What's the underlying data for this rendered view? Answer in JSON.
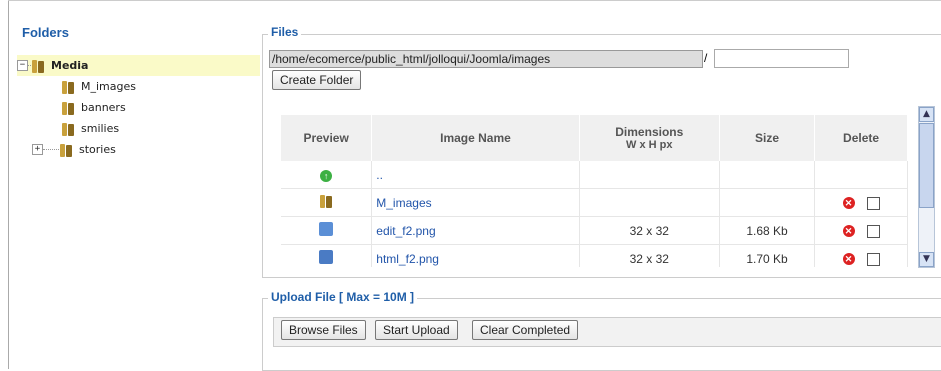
{
  "folders": {
    "title": "Folders",
    "root": "Media",
    "items": [
      {
        "label": "M_images"
      },
      {
        "label": "banners"
      },
      {
        "label": "smilies"
      },
      {
        "label": "stories"
      }
    ],
    "root_expander": "−",
    "stories_expander": "+"
  },
  "files": {
    "legend": "Files",
    "path": "/home/ecomerce/public_html/jolloqui/Joomla/images",
    "slash": "/",
    "new_folder_value": "",
    "create_folder_label": "Create Folder",
    "columns": {
      "preview": "Preview",
      "name": "Image Name",
      "dimensions_line1": "Dimensions",
      "dimensions_line2": "W x H px",
      "size": "Size",
      "delete": "Delete"
    },
    "rows": [
      {
        "name": "..",
        "dimensions": "",
        "size": "",
        "icon": "up-icon"
      },
      {
        "name": "M_images",
        "dimensions": "",
        "size": "",
        "icon": "folder-icon"
      },
      {
        "name": "edit_f2.png",
        "dimensions": "32 x 32",
        "size": "1.68 Kb",
        "icon": "edit-file-icon"
      },
      {
        "name": "html_f2.png",
        "dimensions": "32 x 32",
        "size": "1.70 Kb",
        "icon": "html-file-icon"
      }
    ]
  },
  "upload": {
    "legend": "Upload File [ Max = 10M ]",
    "browse_label": "Browse Files",
    "start_label": "Start Upload",
    "clear_label": "Clear Completed"
  },
  "colors": {
    "accent": "#1f5ea8",
    "tree_selected": "#fafac8",
    "header_bg": "#f0f0f0"
  }
}
